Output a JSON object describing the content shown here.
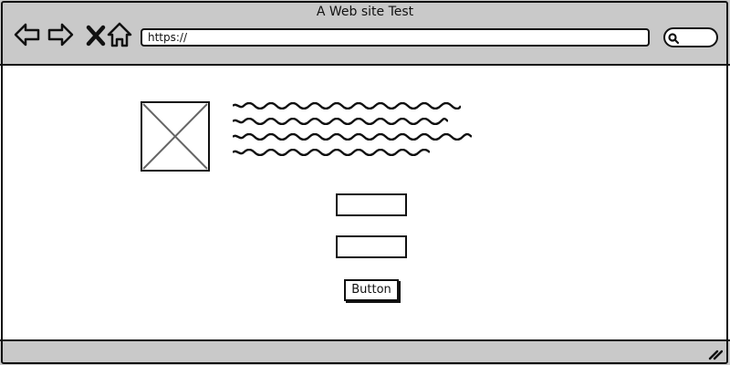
{
  "window": {
    "title": "A Web site Test"
  },
  "toolbar": {
    "back_icon": "back-arrow-icon",
    "forward_icon": "forward-arrow-icon",
    "stop_icon": "close-icon",
    "home_icon": "home-icon",
    "address": "https://",
    "search_icon": "search-icon"
  },
  "content": {
    "image_icon": "image-placeholder-icon",
    "button_label": "Button",
    "fields": [
      {
        "value": ""
      },
      {
        "value": ""
      }
    ]
  },
  "statusbar": {
    "grip_icon": "resize-grip-icon"
  },
  "colors": {
    "chrome": "#c9c9c9",
    "stroke": "#111111",
    "background": "#ffffff"
  }
}
